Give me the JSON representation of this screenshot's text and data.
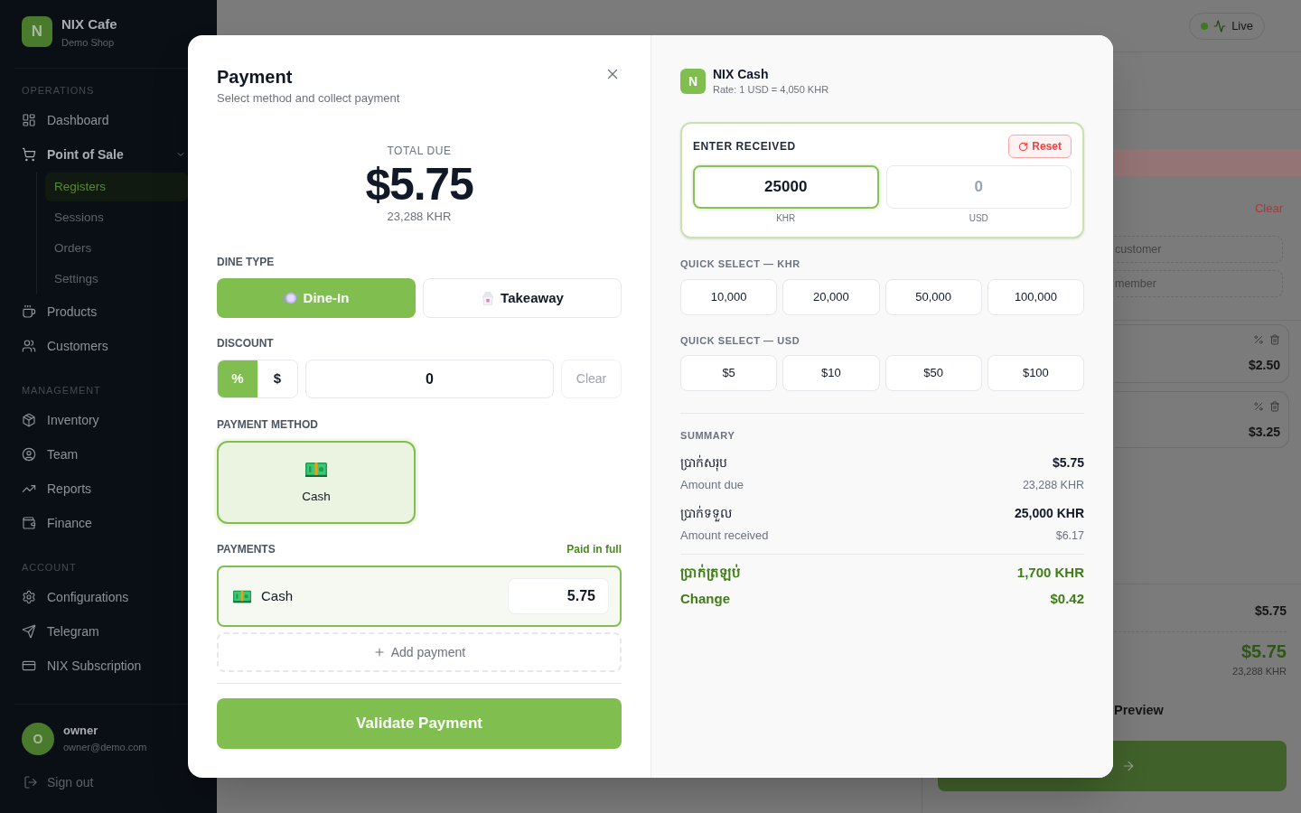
{
  "sidebar": {
    "brand": {
      "logo_letter": "N",
      "name": "NIX Cafe",
      "subtitle": "Demo Shop"
    },
    "sections": [
      {
        "heading": "OPERATIONS",
        "items": [
          {
            "label": "Dashboard",
            "selected": false
          },
          {
            "label": "Point of Sale",
            "selected": false,
            "expanded": true,
            "children": [
              {
                "label": "Registers",
                "selected": true
              },
              {
                "label": "Sessions",
                "selected": false
              },
              {
                "label": "Orders",
                "selected": false
              },
              {
                "label": "Settings",
                "selected": false
              }
            ]
          },
          {
            "label": "Products",
            "selected": false
          },
          {
            "label": "Customers",
            "selected": false
          }
        ]
      },
      {
        "heading": "MANAGEMENT",
        "items": [
          {
            "label": "Inventory",
            "selected": false
          },
          {
            "label": "Team",
            "selected": false
          },
          {
            "label": "Reports",
            "selected": false
          },
          {
            "label": "Finance",
            "selected": false
          }
        ]
      },
      {
        "heading": "ACCOUNT",
        "items": [
          {
            "label": "Configurations",
            "selected": false
          },
          {
            "label": "Telegram",
            "selected": false
          },
          {
            "label": "NIX Subscription",
            "selected": false
          }
        ]
      }
    ],
    "user": {
      "avatar_letter": "O",
      "name": "owner",
      "email": "owner@demo.com"
    },
    "sign_out": "Sign out"
  },
  "header": {
    "live_badge": "Live"
  },
  "cart_panel": {
    "clear": "Clear",
    "customer_field": {
      "placeholder": "customer"
    },
    "member_field": {
      "placeholder": "member"
    },
    "items": [
      {
        "price": "$2.50"
      },
      {
        "price": "$3.25"
      }
    ],
    "subtotal": "$5.75",
    "total": "$5.75",
    "total_khr": "23,288 KHR",
    "preview": "Preview"
  },
  "payment_dialog": {
    "title": "Payment",
    "subtitle": "Select method and collect payment",
    "total_due": {
      "label": "TOTAL DUE",
      "amount": "$5.75",
      "amount_khr": "23,288 KHR"
    },
    "dine_type": {
      "label": "DINE TYPE",
      "options": [
        {
          "label": "Dine-In",
          "selected": true
        },
        {
          "label": "Takeaway",
          "selected": false
        }
      ]
    },
    "discount": {
      "label": "DISCOUNT",
      "modes": [
        {
          "label": "%",
          "selected": true
        },
        {
          "label": "$",
          "selected": false
        }
      ],
      "value": "0",
      "clear": {
        "label": "Clear",
        "disabled": true
      }
    },
    "payment_method": {
      "label": "PAYMENT METHOD",
      "options": [
        {
          "label": "Cash",
          "selected": true
        }
      ]
    },
    "payments": {
      "label": "PAYMENTS",
      "status": "Paid in full",
      "rows": [
        {
          "method": "Cash",
          "amount": "5.75"
        }
      ],
      "add": "Add payment"
    },
    "validate_button": "Validate Payment"
  },
  "cash_panel": {
    "brand": {
      "logo_letter": "N",
      "name": "NIX Cash",
      "rate": "Rate: 1 USD = 4,050 KHR"
    },
    "enter_received": {
      "title": "ENTER RECEIVED",
      "reset": "Reset",
      "fields": [
        {
          "unit": "KHR",
          "value": "25000",
          "focused": true
        },
        {
          "unit": "USD",
          "placeholder": "0",
          "focused": false
        }
      ]
    },
    "quick_select": [
      {
        "label": "QUICK SELECT — KHR",
        "amounts": [
          "10,000",
          "20,000",
          "50,000",
          "100,000"
        ]
      },
      {
        "label": "QUICK SELECT — USD",
        "amounts": [
          "$5",
          "$10",
          "$50",
          "$100"
        ]
      }
    ],
    "summary": {
      "label": "SUMMARY",
      "rows": [
        {
          "kind": "amount",
          "label_km": "ប្រាក់សរុប",
          "value": "$5.75",
          "label": "Amount due",
          "sub_value": "23,288 KHR"
        },
        {
          "kind": "amount",
          "label_km": "ប្រាក់ទទួល",
          "value": "25,000 KHR",
          "label": "Amount received",
          "sub_value": "$6.17"
        },
        {
          "kind": "change",
          "label_km": "ប្រាក់ត្រឡប់",
          "value": "1,700 KHR",
          "label": "Change",
          "sub_value": "$0.42"
        }
      ]
    }
  }
}
